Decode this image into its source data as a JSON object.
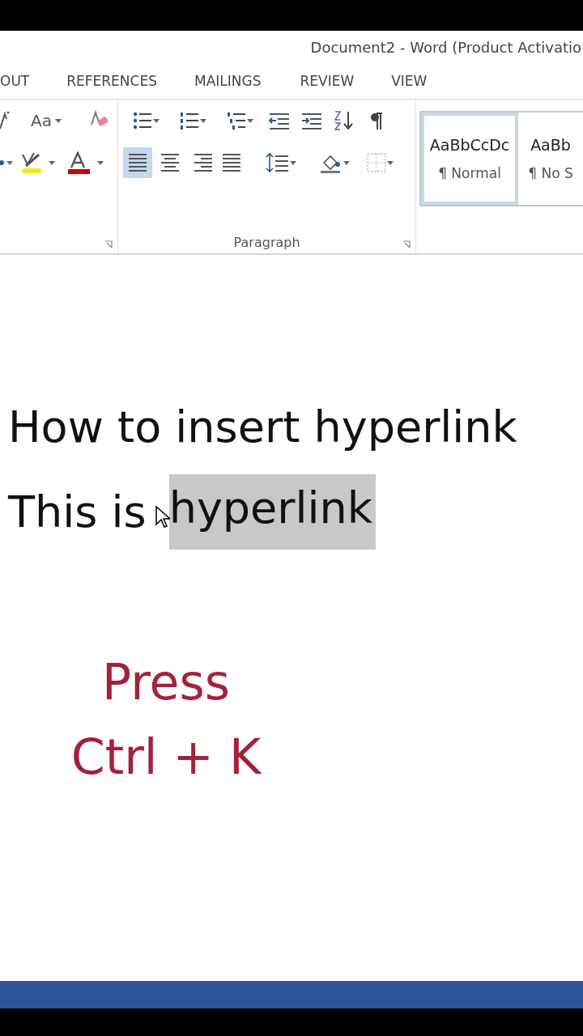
{
  "window": {
    "title": "Document2 - Word (Product Activatio"
  },
  "tabs": [
    {
      "label": "OUT"
    },
    {
      "label": "REFERENCES"
    },
    {
      "label": "MAILINGS"
    },
    {
      "label": "REVIEW"
    },
    {
      "label": "VIEW"
    }
  ],
  "ribbon": {
    "font_group": {
      "change_case": "Aa"
    },
    "paragraph_group": {
      "label": "Paragraph",
      "alignment": [
        {
          "selected": true
        },
        {
          "selected": false
        },
        {
          "selected": false
        },
        {
          "selected": false
        }
      ]
    },
    "styles": [
      {
        "preview": "AaBbCcDc",
        "name": "¶ Normal",
        "selected": true
      },
      {
        "preview": "AaBb",
        "name": "¶ No S",
        "selected": false
      }
    ]
  },
  "document": {
    "heading": "How to insert hyperlink",
    "line": {
      "text": "This is ",
      "selected_text": "hyperlink"
    }
  },
  "caption": [
    "Press",
    "Ctrl + K"
  ]
}
